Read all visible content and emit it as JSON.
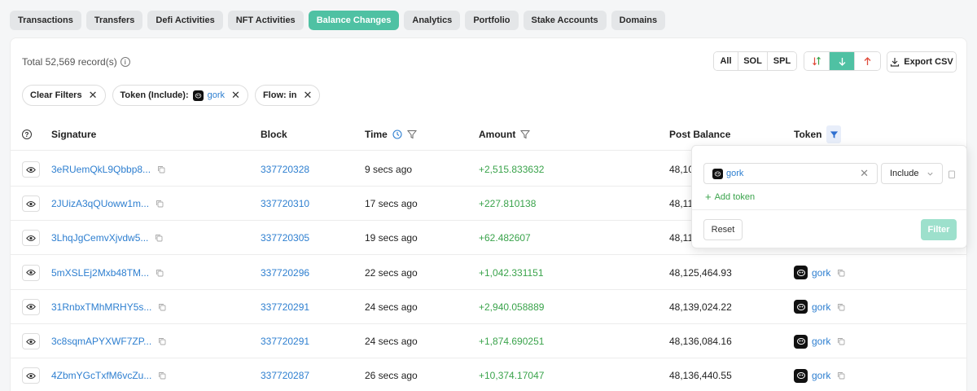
{
  "tabs": [
    {
      "label": "Transactions",
      "active": false
    },
    {
      "label": "Transfers",
      "active": false
    },
    {
      "label": "Defi Activities",
      "active": false
    },
    {
      "label": "NFT Activities",
      "active": false
    },
    {
      "label": "Balance Changes",
      "active": true
    },
    {
      "label": "Analytics",
      "active": false
    },
    {
      "label": "Portfolio",
      "active": false
    },
    {
      "label": "Stake Accounts",
      "active": false
    },
    {
      "label": "Domains",
      "active": false
    }
  ],
  "summary": {
    "total_label": "Total 52,569 record(s)"
  },
  "asset_filter": {
    "all": "All",
    "sol": "SOL",
    "spl": "SPL",
    "selected": "All"
  },
  "export_label": "Export CSV",
  "chips": {
    "clear": "Clear Filters",
    "token_prefix": "Token (Include):",
    "token_value": "gork",
    "flow": "Flow: in"
  },
  "columns": {
    "signature": "Signature",
    "block": "Block",
    "time": "Time",
    "amount": "Amount",
    "post_balance": "Post Balance",
    "token": "Token"
  },
  "rows": [
    {
      "signature": "3eRUemQkL9Qbbp8...",
      "block": "337720328",
      "time": "9 secs ago",
      "amount": "+2,515.833632",
      "post_balance": "48,10",
      "token": ""
    },
    {
      "signature": "2JUizA3qQUoww1m...",
      "block": "337720310",
      "time": "17 secs ago",
      "amount": "+227.810138",
      "post_balance": "48,11",
      "token": ""
    },
    {
      "signature": "3LhqJgCemvXjvdw5...",
      "block": "337720305",
      "time": "19 secs ago",
      "amount": "+62.482607",
      "post_balance": "48,11",
      "token": ""
    },
    {
      "signature": "5mXSLEj2Mxb48TM...",
      "block": "337720296",
      "time": "22 secs ago",
      "amount": "+1,042.331151",
      "post_balance": "48,125,464.93",
      "token": "gork"
    },
    {
      "signature": "31RnbxTMhMRHY5s...",
      "block": "337720291",
      "time": "24 secs ago",
      "amount": "+2,940.058889",
      "post_balance": "48,139,024.22",
      "token": "gork"
    },
    {
      "signature": "3c8sqmAPYXWF7ZP...",
      "block": "337720291",
      "time": "24 secs ago",
      "amount": "+1,874.690251",
      "post_balance": "48,136,084.16",
      "token": "gork"
    },
    {
      "signature": "4ZbmYGcTxfM6vcZu...",
      "block": "337720287",
      "time": "26 secs ago",
      "amount": "+10,374.17047",
      "post_balance": "48,136,440.55",
      "token": "gork"
    }
  ],
  "token_popup": {
    "token_value": "gork",
    "mode": "Include",
    "add_token": "Add token",
    "reset": "Reset",
    "filter": "Filter"
  },
  "colors": {
    "accent": "#4fc1a3",
    "link": "#2e7fd0",
    "positive": "#3aa34b"
  }
}
